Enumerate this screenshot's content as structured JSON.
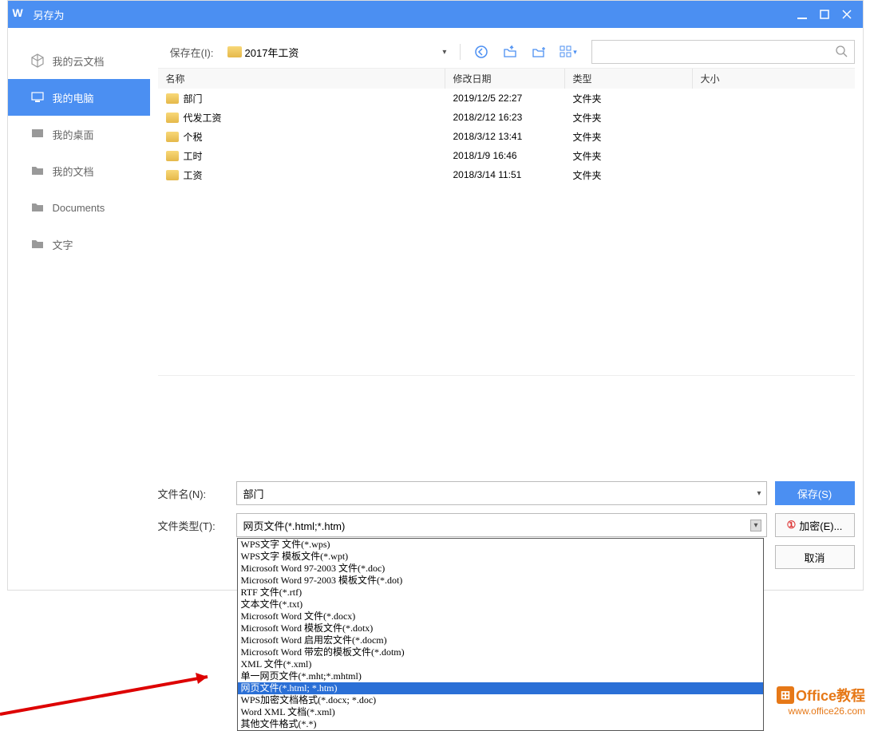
{
  "title": "另存为",
  "sidebar": {
    "items": [
      {
        "label": "我的云文档",
        "active": false
      },
      {
        "label": "我的电脑",
        "active": true
      },
      {
        "label": "我的桌面",
        "active": false
      },
      {
        "label": "我的文档",
        "active": false
      },
      {
        "label": "Documents",
        "active": false
      },
      {
        "label": "文字",
        "active": false
      }
    ]
  },
  "toolbar": {
    "save_in_label": "保存在(I):",
    "current_folder": "2017年工资"
  },
  "columns": {
    "name": "名称",
    "date": "修改日期",
    "type": "类型",
    "size": "大小"
  },
  "files": [
    {
      "name": "部门",
      "date": "2019/12/5 22:27",
      "type": "文件夹"
    },
    {
      "name": "代发工资",
      "date": "2018/2/12 16:23",
      "type": "文件夹"
    },
    {
      "name": "个税",
      "date": "2018/3/12 13:41",
      "type": "文件夹"
    },
    {
      "name": "工时",
      "date": "2018/1/9 16:46",
      "type": "文件夹"
    },
    {
      "name": "工资",
      "date": "2018/3/14 11:51",
      "type": "文件夹"
    }
  ],
  "fields": {
    "filename_label": "文件名(N):",
    "filename_value": "部门",
    "filetype_label": "文件类型(T):",
    "filetype_value": "网页文件(*.html;*.htm)"
  },
  "buttons": {
    "save": "保存(S)",
    "encrypt": "加密(E)...",
    "cancel": "取消"
  },
  "dropdown": {
    "options": [
      "WPS文字 文件(*.wps)",
      "WPS文字 模板文件(*.wpt)",
      "Microsoft Word 97-2003 文件(*.doc)",
      "Microsoft Word 97-2003 模板文件(*.dot)",
      "RTF 文件(*.rtf)",
      "文本文件(*.txt)",
      "Microsoft Word 文件(*.docx)",
      "Microsoft Word 模板文件(*.dotx)",
      "Microsoft Word 启用宏文件(*.docm)",
      "Microsoft Word 带宏的模板文件(*.dotm)",
      "XML 文件(*.xml)",
      "单一网页文件(*.mht;*.mhtml)",
      "网页文件(*.html; *.htm)",
      "WPS加密文档格式(*.docx; *.doc)",
      "Word XML 文档(*.xml)",
      "其他文件格式(*.*)"
    ],
    "selected_index": 12
  },
  "watermark": {
    "brand": "Office教程",
    "url": "www.office26.com"
  }
}
